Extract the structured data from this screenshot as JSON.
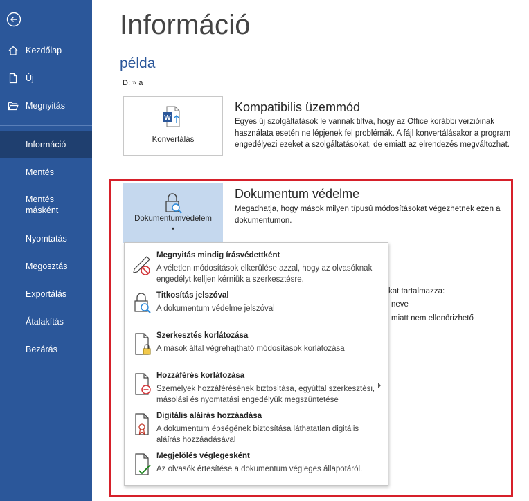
{
  "sidebar": {
    "items": [
      {
        "label": "Kezdőlap"
      },
      {
        "label": "Új"
      },
      {
        "label": "Megnyitás"
      },
      {
        "label": "Információ"
      },
      {
        "label": "Mentés"
      },
      {
        "label": "Mentés\nmásként"
      },
      {
        "label": "Nyomtatás"
      },
      {
        "label": "Megosztás"
      },
      {
        "label": "Exportálás"
      },
      {
        "label": "Átalakítás"
      },
      {
        "label": "Bezárás"
      }
    ]
  },
  "main": {
    "title": "Információ",
    "doc_name": "példa",
    "doc_path": "D: » a",
    "compat": {
      "button_label": "Konvertálás",
      "title": "Kompatibilis üzemmód",
      "description": "Egyes új szolgáltatások le vannak tiltva, hogy az Office korábbi verzióinak használata esetén ne lépjenek fel problémák. A fájl konvertálásakor a program engedélyezi ezeket a szolgáltatásokat, de emiatt az elrendezés megváltozhat."
    },
    "protect": {
      "button_label": "Dokumentumvédelem",
      "caret": "▾",
      "title": "Dokumentum védelme",
      "description": "Megadhatja, hogy mások milyen típusú módosításokat végezhetnek ezen a dokumentumon."
    },
    "background_lines": [
      "kat tartalmazza:",
      "neve",
      "miatt nem ellenőrizhető"
    ]
  },
  "dropdown": {
    "items": [
      {
        "title": "Megnyitás mindig írásvédettként",
        "description": "A véletlen módosítások elkerülése azzal, hogy az olvasóknak engedélyt kelljen kérniük a szerkesztésre."
      },
      {
        "title": "Titkosítás jelszóval",
        "description": "A dokumentum védelme jelszóval"
      },
      {
        "title": "Szerkesztés korlátozása",
        "description": "A mások által végrehajtható módosítások korlátozása"
      },
      {
        "title": "Hozzáférés korlátozása",
        "description": "Személyek hozzáférésének biztosítása, egyúttal szerkesztési, másolási és nyomtatási engedélyük megszüntetése"
      },
      {
        "title": "Digitális aláírás hozzáadása",
        "description": "A dokumentum épségének biztosítása láthatatlan digitális aláírás hozzáadásával"
      },
      {
        "title": "Megjelölés véglegesként",
        "description": "Az olvasók értesítése a dokumentum végleges állapotáról."
      }
    ]
  },
  "colors": {
    "sidebar": "#2b579a",
    "sidebar_active": "#1f3f6f",
    "accent_text": "#2b579a",
    "highlight_frame": "#d6202a",
    "protect_tile": "#c5d8ee"
  },
  "icons": {
    "back": "back-arrow-icon",
    "home": "home-icon",
    "new": "new-document-icon",
    "open": "folder-open-icon",
    "convert": "word-convert-icon",
    "protect": "lock-search-icon"
  }
}
